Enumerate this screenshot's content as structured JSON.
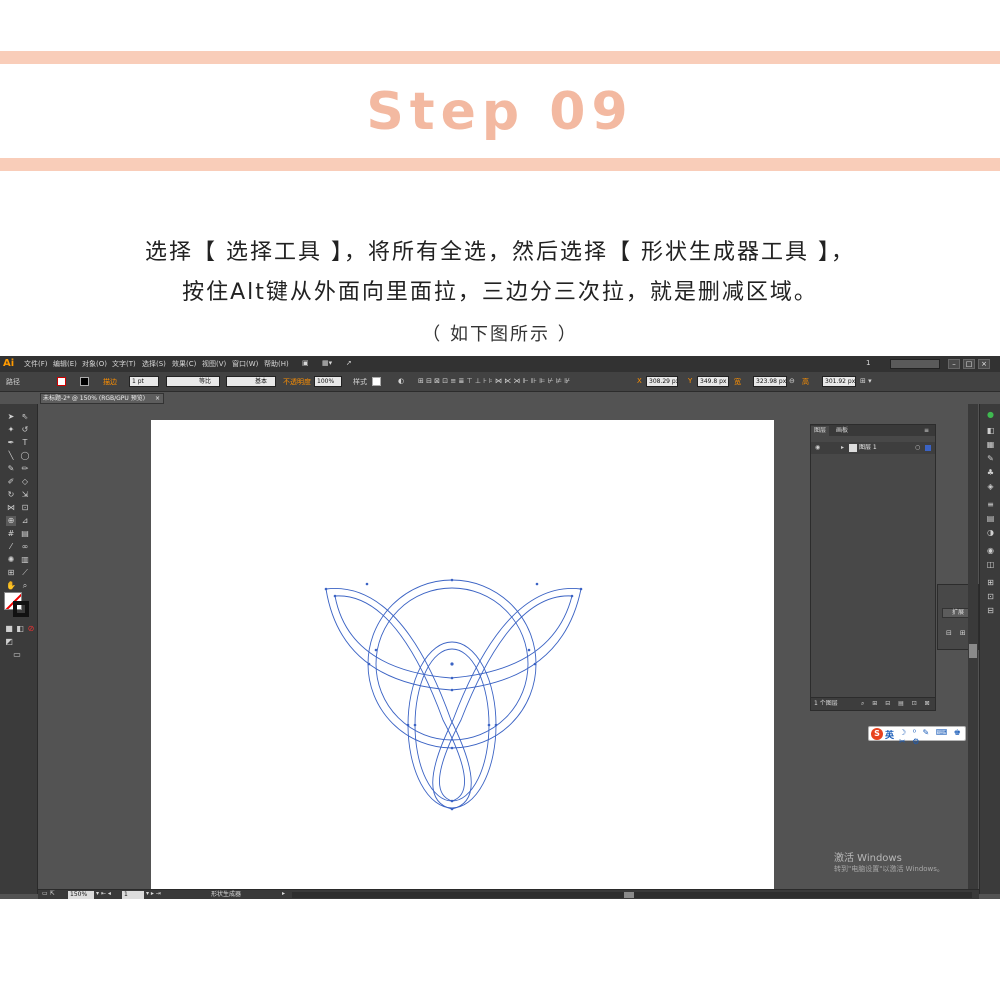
{
  "header": {
    "title": "Step 09",
    "accent_color": "#f3b9a1",
    "band_color": "#f9cdb9"
  },
  "instructions": {
    "line1": "选择【 选择工具 】，将所有全选，然后选择【 形状生成器工具 】，",
    "line2": "按住Alt键从外面向里面拉，三边分三次拉，就是删减区域。",
    "caption": "（ 如下图所示 ）"
  },
  "app": {
    "logo": "Ai",
    "menu": [
      "文件(F)",
      "编辑(E)",
      "对象(O)",
      "文字(T)",
      "选择(S)",
      "效果(C)",
      "视图(V)",
      "窗口(W)",
      "帮助(H)"
    ],
    "zoom_readout": "1",
    "window_buttons": [
      "–",
      "□",
      "×"
    ],
    "control_bar": {
      "object_type": "路径",
      "stroke_label": "描边",
      "stroke_weight": "1 pt",
      "profile": "等比",
      "brush": "基本",
      "opacity_label": "不透明度",
      "opacity": "100%",
      "style_label": "样式",
      "x_label": "X",
      "x": "308.29 px",
      "y_label": "Y",
      "y": "349.8 px",
      "w_label": "宽",
      "w": "323.98 px",
      "h_label": "高",
      "h": "301.92 px"
    },
    "doc_tab": {
      "label": "未标题-2* @ 150% (RGB/GPU 预览)",
      "close": "×"
    },
    "layers_panel": {
      "tabs": [
        "图层",
        "画板"
      ],
      "layer_name": "图层 1",
      "layer_count": "1 个图层"
    },
    "sub_panel": {
      "expand_button": "扩展"
    },
    "ime": {
      "logo": "S",
      "lang": "英"
    },
    "activate_windows": {
      "title": "激活 Windows",
      "subtitle": "转到\"电脑设置\"以激活 Windows。"
    },
    "status_bar": {
      "zoom": "150%",
      "page": "1",
      "tool": "形状生成器"
    },
    "path_color": "#3b63c4",
    "canvas_color": "#535353"
  }
}
